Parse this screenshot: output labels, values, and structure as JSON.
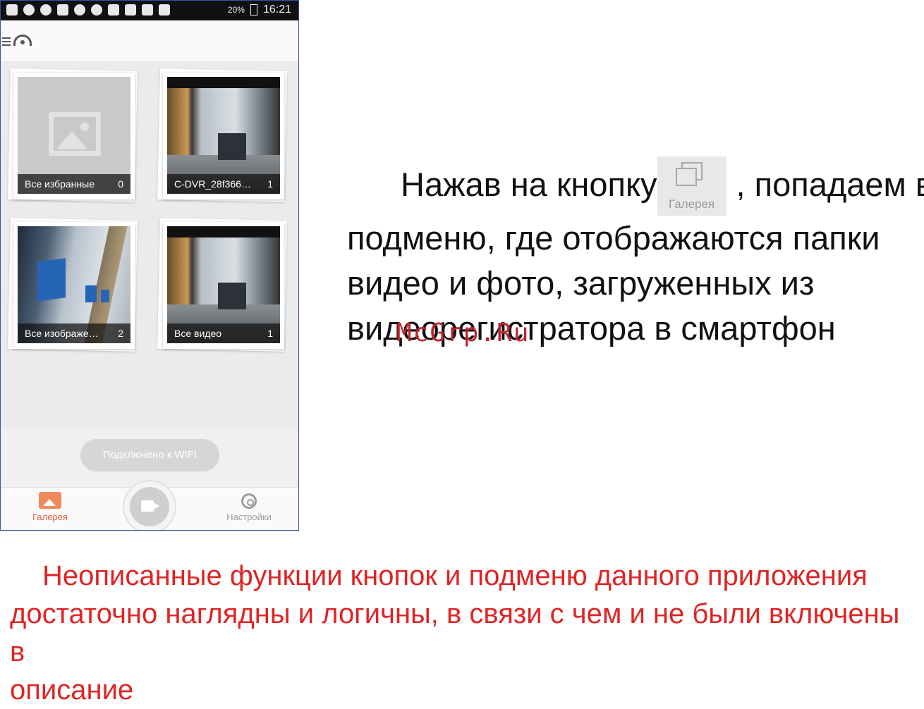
{
  "status_bar": {
    "battery_percent": "20%",
    "time": "16:21"
  },
  "albums": [
    {
      "name": "Все избранные",
      "count": "0"
    },
    {
      "name": "C-DVR_28f366…",
      "count": "1"
    },
    {
      "name": "Все изображе…",
      "count": "2"
    },
    {
      "name": "Все видео",
      "count": "1"
    }
  ],
  "toast": "Подключено к WIFI",
  "nav": {
    "gallery_label": "Галерея",
    "settings_label": "Настройки"
  },
  "description": {
    "line1_before": "Нажав на кнопку",
    "line1_after": ", попадаем в",
    "button_label": "Галерея",
    "line2": "подменю, где отображаются папки",
    "line3": "видео и фото, загруженных из",
    "line4": "видеорегистратора в смартфон"
  },
  "watermark": "McGrp.Ru",
  "note": {
    "line1": "Неописанные функции кнопок и подменю данного приложения",
    "line2": "достаточно наглядны и логичны, в связи с чем и не были включены в",
    "line3": "описание"
  },
  "colors": {
    "accent": "#e8593d",
    "note_text": "#e02424",
    "watermark": "#c0272d"
  }
}
